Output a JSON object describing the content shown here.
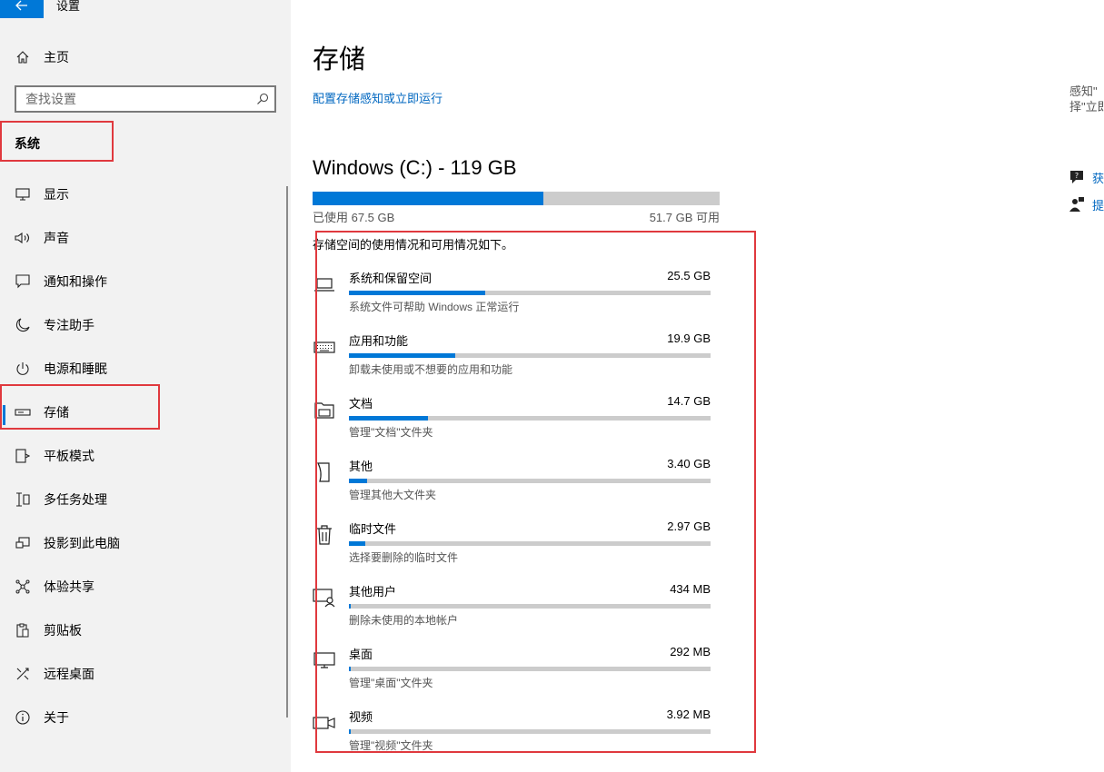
{
  "window": {
    "title": "设置"
  },
  "sidebar": {
    "home_label": "主页",
    "search_placeholder": "查找设置",
    "section_title": "系统",
    "items": [
      {
        "label": "显示",
        "icon": "monitor-icon"
      },
      {
        "label": "声音",
        "icon": "speaker-icon"
      },
      {
        "label": "通知和操作",
        "icon": "notification-icon"
      },
      {
        "label": "专注助手",
        "icon": "moon-icon"
      },
      {
        "label": "电源和睡眠",
        "icon": "power-icon"
      },
      {
        "label": "存储",
        "icon": "storage-icon",
        "active": true
      },
      {
        "label": "平板模式",
        "icon": "tablet-icon"
      },
      {
        "label": "多任务处理",
        "icon": "multitask-icon"
      },
      {
        "label": "投影到此电脑",
        "icon": "project-icon"
      },
      {
        "label": "体验共享",
        "icon": "share-icon"
      },
      {
        "label": "剪贴板",
        "icon": "clipboard-icon"
      },
      {
        "label": "远程桌面",
        "icon": "remote-icon"
      },
      {
        "label": "关于",
        "icon": "info-icon"
      }
    ]
  },
  "main": {
    "title": "存储",
    "config_link": "配置存储感知或立即运行",
    "drive": {
      "title": "Windows (C:) - 119 GB",
      "used_fraction": 0.567,
      "used_label": "已使用 67.5 GB",
      "free_label": "51.7 GB 可用"
    },
    "description": "存储空间的使用情况和可用情况如下。",
    "categories": [
      {
        "name": "系统和保留空间",
        "size": "25.5 GB",
        "sub": "系统文件可帮助 Windows 正常运行",
        "fraction": 0.378,
        "icon": "laptop-icon"
      },
      {
        "name": "应用和功能",
        "size": "19.9 GB",
        "sub": "卸载未使用或不想要的应用和功能",
        "fraction": 0.295,
        "icon": "keyboard-icon"
      },
      {
        "name": "文档",
        "size": "14.7 GB",
        "sub": "管理\"文档\"文件夹",
        "fraction": 0.218,
        "icon": "document-folder-icon"
      },
      {
        "name": "其他",
        "size": "3.40 GB",
        "sub": "管理其他大文件夹",
        "fraction": 0.05,
        "icon": "other-files-icon"
      },
      {
        "name": "临时文件",
        "size": "2.97 GB",
        "sub": "选择要删除的临时文件",
        "fraction": 0.044,
        "icon": "trash-icon"
      },
      {
        "name": "其他用户",
        "size": "434 MB",
        "sub": "删除未使用的本地帐户",
        "fraction": 0.006,
        "icon": "user-monitor-icon"
      },
      {
        "name": "桌面",
        "size": "292 MB",
        "sub": "管理\"桌面\"文件夹",
        "fraction": 0.004,
        "icon": "desktop-icon"
      },
      {
        "name": "视频",
        "size": "3.92 MB",
        "sub": "管理\"视频\"文件夹",
        "fraction": 0.001,
        "icon": "video-icon"
      }
    ]
  },
  "right_panel": {
    "text_line1": "感知\"",
    "text_line2": "择\"立即",
    "link1": "获",
    "link2": "提"
  },
  "colors": {
    "accent": "#0078d7",
    "link": "#0067c0",
    "highlight": "#e0393e",
    "sidebar_bg": "#f2f2f2"
  }
}
